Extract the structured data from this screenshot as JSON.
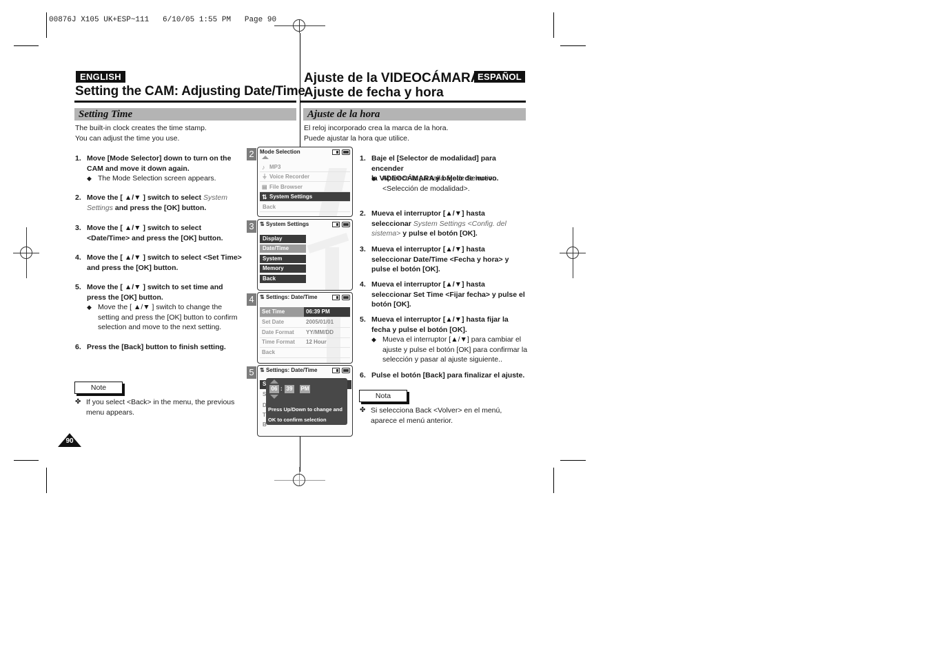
{
  "print_header": "00876J X105 UK+ESP~111   6/10/05 1:55 PM   Page 90",
  "english": {
    "badge": "ENGLISH",
    "title": "Setting the CAM: Adjusting Date/Time",
    "section": "Setting Time",
    "intro": [
      "The built-in clock creates the time stamp.",
      "You can adjust the time you use."
    ],
    "steps": [
      {
        "num": "1.",
        "lines": [
          "Move [Mode Selector] down to turn on the",
          "CAM and move it down again."
        ],
        "bullet": [
          "The Mode Selection screen appears."
        ]
      },
      {
        "num": "2.",
        "pre": "Move the [ ▲/▼ ] switch to select ",
        "italic1": "System",
        "italic2": "Settings",
        "post": " and press the [OK] button."
      },
      {
        "num": "3.",
        "lines": [
          "Move the [ ▲/▼ ] switch to select",
          "<Date/Time> and press the [OK] button."
        ]
      },
      {
        "num": "4.",
        "lines": [
          "Move the [ ▲/▼ ] switch to select <Set Time>",
          "and press the [OK] button."
        ]
      },
      {
        "num": "5.",
        "lines": [
          "Move the [ ▲/▼ ] switch to set time and",
          "press the [OK] button."
        ],
        "bullet": [
          "Move the [ ▲/▼ ] switch to change the",
          "setting and press the [OK] button to confirm",
          "selection and move to the next setting."
        ]
      },
      {
        "num": "6.",
        "lines": [
          "Press the [Back] button to finish setting."
        ]
      }
    ],
    "note_label": "Note",
    "note_symbol": "✤",
    "note_text": [
      "If you select <Back> in the menu, the previous",
      "menu appears."
    ],
    "bullet_symbol": "◆"
  },
  "spanish": {
    "badge": "ESPAÑOL",
    "title_line1": "Ajuste de la VIDEOCÁMARA:",
    "title_line2": "Ajuste de fecha y hora",
    "section": "Ajuste de la hora",
    "intro": [
      "El reloj incorporado crea la marca de la hora.",
      "Puede ajustar la hora que utilice."
    ],
    "steps": [
      {
        "num": "1.",
        "lines": [
          "Baje el [Selector de modalidad] para encender",
          "la VIDEOCÁMARA y bájelo de nuevo."
        ],
        "bullet": [
          "Aparece la pantalla Mode Selection",
          "<Selección de modalidad>."
        ]
      },
      {
        "num": "2.",
        "line1": "Mueva el interruptor [▲/▼] hasta",
        "pre2": "seleccionar ",
        "italic2": "System Settings <Config. del",
        "italic3": "sistema>",
        "post3": " y pulse el botón [OK]."
      },
      {
        "num": "3.",
        "lines": [
          "Mueva el interruptor [▲/▼] hasta",
          "seleccionar Date/Time <Fecha y hora> y",
          "pulse el botón [OK]."
        ]
      },
      {
        "num": "4.",
        "lines": [
          "Mueva el interruptor [▲/▼] hasta",
          "seleccionar Set Time <Fijar fecha> y pulse el",
          "botón [OK]."
        ]
      },
      {
        "num": "5.",
        "lines": [
          "Mueva el interruptor [▲/▼] hasta fijar la",
          "fecha y pulse el botón [OK]."
        ],
        "bullet": [
          "Mueva el interruptor [▲/▼] para cambiar el",
          "ajuste y pulse el botón [OK] para confirmar la",
          "selección y pasar al ajuste siguiente.."
        ]
      },
      {
        "num": "6.",
        "lines": [
          "Pulse el botón [Back] para finalizar el ajuste."
        ]
      }
    ],
    "note_label": "Nota",
    "note_text": [
      "Si selecciona Back <Volver> en el menú,",
      "aparece el menú anterior."
    ]
  },
  "screens": [
    {
      "num": "2",
      "title": "Mode Selection",
      "items": [
        {
          "icon": "♪",
          "label": "MP3"
        },
        {
          "icon": "🎙",
          "label": "Voice Recorder"
        },
        {
          "icon": "🖹",
          "label": "File Browser"
        },
        {
          "icon": "⇅",
          "label": "System Settings",
          "selected": true
        },
        {
          "icon": "",
          "label": "Back"
        }
      ]
    },
    {
      "num": "3",
      "title": "System Settings",
      "items": [
        {
          "label": "Display"
        },
        {
          "label": "Date/Time",
          "selected": true
        },
        {
          "label": "System"
        },
        {
          "label": "Memory"
        },
        {
          "label": "Back"
        }
      ]
    },
    {
      "num": "4",
      "title": "Settings: Date/Time",
      "rows": [
        {
          "key": "Set Time",
          "value": "06:39 PM",
          "selected": true
        },
        {
          "key": "Set Date",
          "value": "2005/01/01"
        },
        {
          "key": "Date Format",
          "value": "YY/MM/DD"
        },
        {
          "key": "Time Format",
          "value": "12 Hour"
        },
        {
          "key": "Back",
          "value": ""
        }
      ]
    },
    {
      "num": "5",
      "title": "Settings: Date/Time",
      "hour": "06",
      "sep": ":",
      "minute": "39",
      "ampm": "PM",
      "hint": [
        "Press Up/Down to change and",
        "OK to confirm selection"
      ],
      "peek": [
        "S",
        "S",
        "D",
        "T",
        "B"
      ]
    }
  ],
  "page_number": "90"
}
